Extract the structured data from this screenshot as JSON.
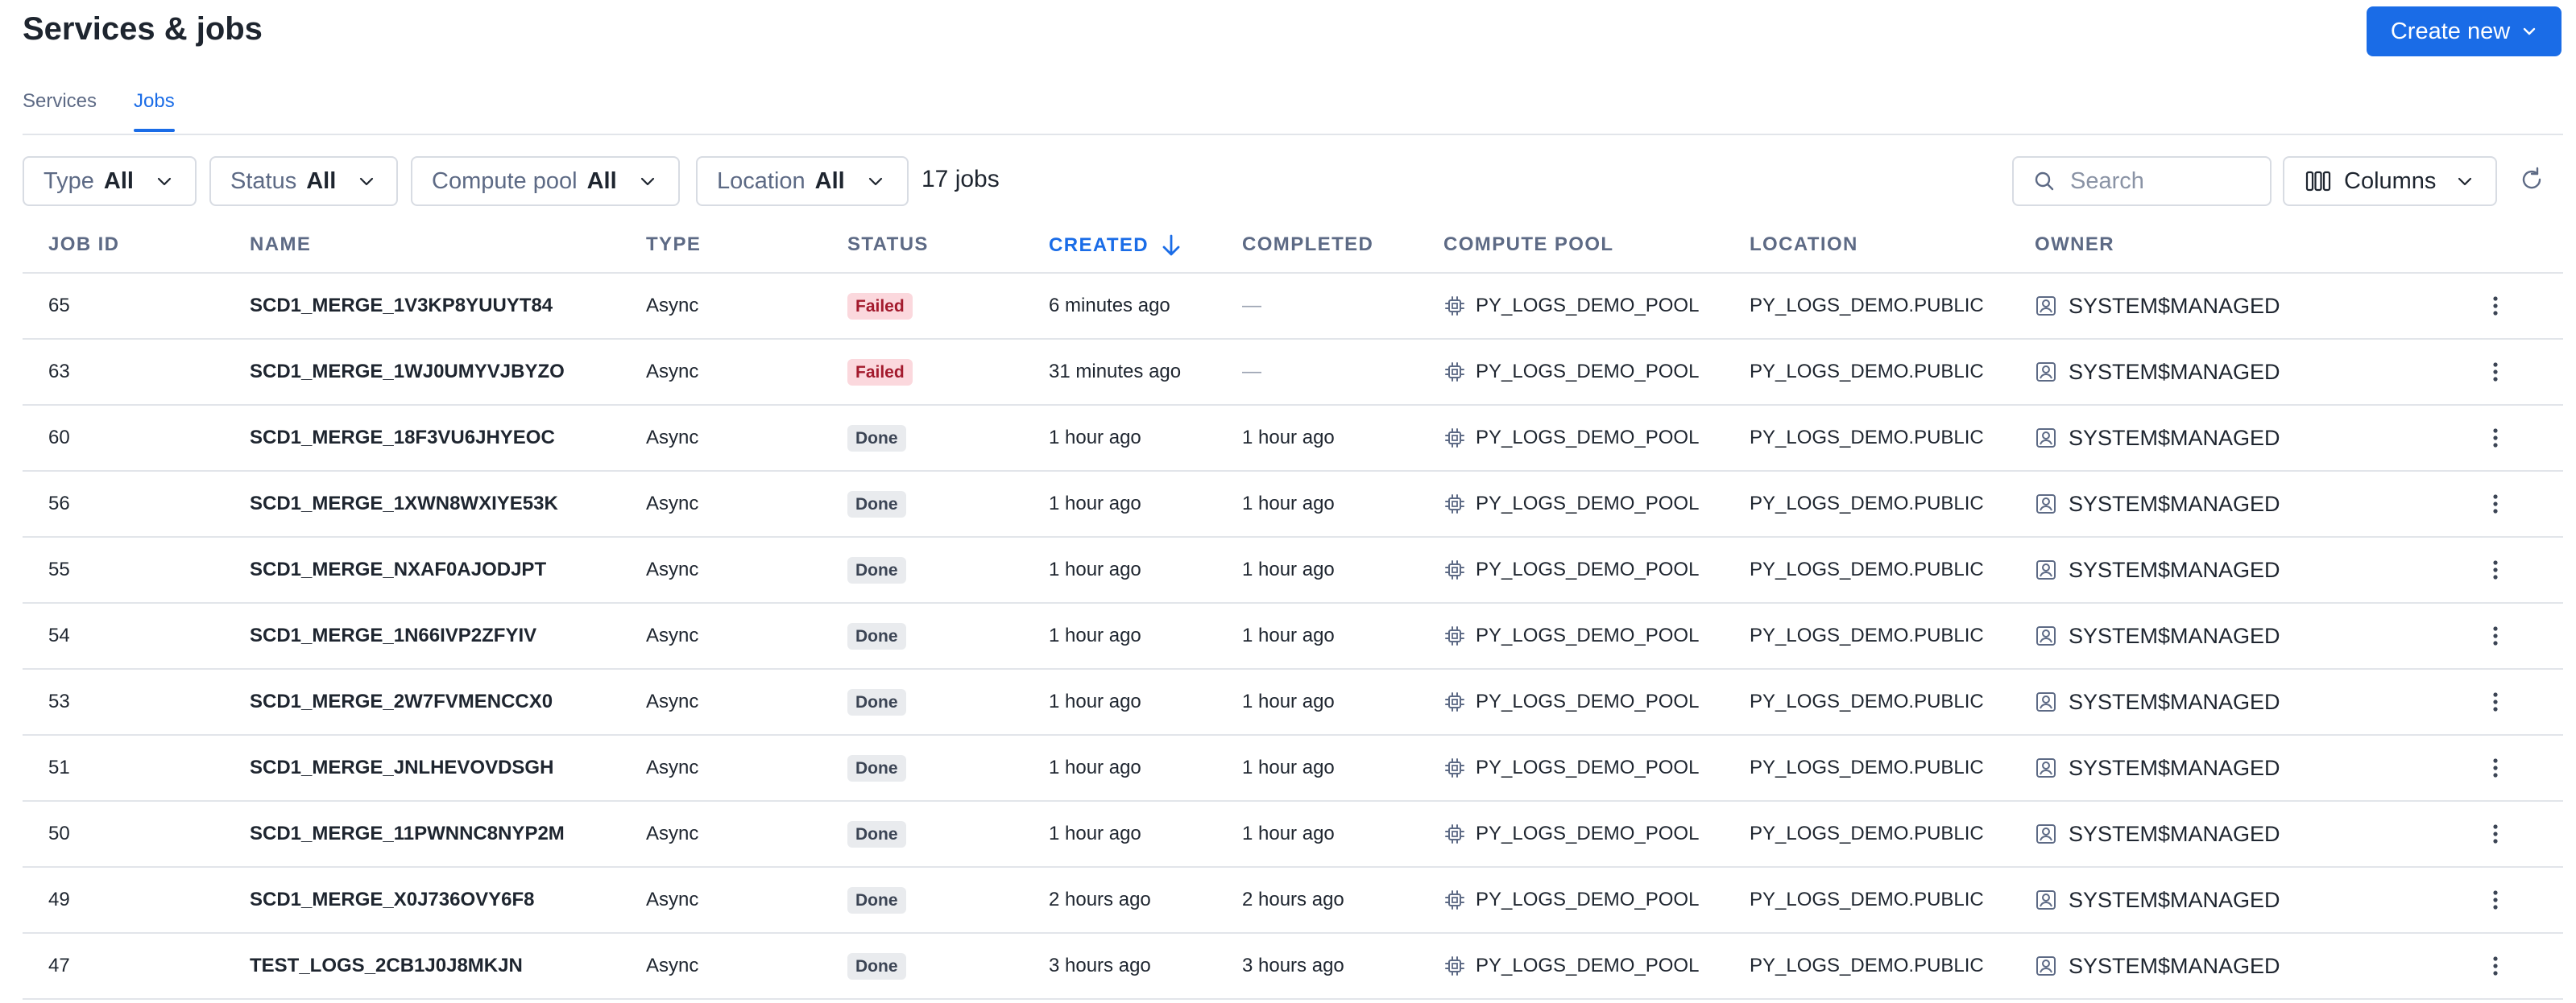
{
  "header": {
    "title": "Services & jobs",
    "create_label": "Create new"
  },
  "tabs": [
    {
      "label": "Services"
    },
    {
      "label": "Jobs"
    }
  ],
  "filters": [
    {
      "label": "Type",
      "value": "All"
    },
    {
      "label": "Status",
      "value": "All"
    },
    {
      "label": "Compute pool",
      "value": "All"
    },
    {
      "label": "Location",
      "value": "All"
    }
  ],
  "jobs_count": "17 jobs",
  "search": {
    "placeholder": "Search"
  },
  "columns_label": "Columns",
  "table": {
    "columns": [
      "JOB ID",
      "NAME",
      "TYPE",
      "STATUS",
      "CREATED",
      "COMPLETED",
      "COMPUTE POOL",
      "LOCATION",
      "OWNER"
    ],
    "sorted_column": "CREATED",
    "rows": [
      {
        "id": "65",
        "name": "SCD1_MERGE_1V3KP8YUUYT84",
        "type": "Async",
        "status": "Failed",
        "created": "6 minutes ago",
        "completed": "—",
        "pool": "PY_LOGS_DEMO_POOL",
        "location": "PY_LOGS_DEMO.PUBLIC",
        "owner": "SYSTEM$MANAGED"
      },
      {
        "id": "63",
        "name": "SCD1_MERGE_1WJ0UMYVJBYZO",
        "type": "Async",
        "status": "Failed",
        "created": "31 minutes ago",
        "completed": "—",
        "pool": "PY_LOGS_DEMO_POOL",
        "location": "PY_LOGS_DEMO.PUBLIC",
        "owner": "SYSTEM$MANAGED"
      },
      {
        "id": "60",
        "name": "SCD1_MERGE_18F3VU6JHYEOC",
        "type": "Async",
        "status": "Done",
        "created": "1 hour ago",
        "completed": "1 hour ago",
        "pool": "PY_LOGS_DEMO_POOL",
        "location": "PY_LOGS_DEMO.PUBLIC",
        "owner": "SYSTEM$MANAGED"
      },
      {
        "id": "56",
        "name": "SCD1_MERGE_1XWN8WXIYE53K",
        "type": "Async",
        "status": "Done",
        "created": "1 hour ago",
        "completed": "1 hour ago",
        "pool": "PY_LOGS_DEMO_POOL",
        "location": "PY_LOGS_DEMO.PUBLIC",
        "owner": "SYSTEM$MANAGED"
      },
      {
        "id": "55",
        "name": "SCD1_MERGE_NXAF0AJODJPT",
        "type": "Async",
        "status": "Done",
        "created": "1 hour ago",
        "completed": "1 hour ago",
        "pool": "PY_LOGS_DEMO_POOL",
        "location": "PY_LOGS_DEMO.PUBLIC",
        "owner": "SYSTEM$MANAGED"
      },
      {
        "id": "54",
        "name": "SCD1_MERGE_1N66IVP2ZFYIV",
        "type": "Async",
        "status": "Done",
        "created": "1 hour ago",
        "completed": "1 hour ago",
        "pool": "PY_LOGS_DEMO_POOL",
        "location": "PY_LOGS_DEMO.PUBLIC",
        "owner": "SYSTEM$MANAGED"
      },
      {
        "id": "53",
        "name": "SCD1_MERGE_2W7FVMENCCX0",
        "type": "Async",
        "status": "Done",
        "created": "1 hour ago",
        "completed": "1 hour ago",
        "pool": "PY_LOGS_DEMO_POOL",
        "location": "PY_LOGS_DEMO.PUBLIC",
        "owner": "SYSTEM$MANAGED"
      },
      {
        "id": "51",
        "name": "SCD1_MERGE_JNLHEVOVDSGH",
        "type": "Async",
        "status": "Done",
        "created": "1 hour ago",
        "completed": "1 hour ago",
        "pool": "PY_LOGS_DEMO_POOL",
        "location": "PY_LOGS_DEMO.PUBLIC",
        "owner": "SYSTEM$MANAGED"
      },
      {
        "id": "50",
        "name": "SCD1_MERGE_11PWNNC8NYP2M",
        "type": "Async",
        "status": "Done",
        "created": "1 hour ago",
        "completed": "1 hour ago",
        "pool": "PY_LOGS_DEMO_POOL",
        "location": "PY_LOGS_DEMO.PUBLIC",
        "owner": "SYSTEM$MANAGED"
      },
      {
        "id": "49",
        "name": "SCD1_MERGE_X0J736OVY6F8",
        "type": "Async",
        "status": "Done",
        "created": "2 hours ago",
        "completed": "2 hours ago",
        "pool": "PY_LOGS_DEMO_POOL",
        "location": "PY_LOGS_DEMO.PUBLIC",
        "owner": "SYSTEM$MANAGED"
      },
      {
        "id": "47",
        "name": "TEST_LOGS_2CB1J0J8MKJN",
        "type": "Async",
        "status": "Done",
        "created": "3 hours ago",
        "completed": "3 hours ago",
        "pool": "PY_LOGS_DEMO_POOL",
        "location": "PY_LOGS_DEMO.PUBLIC",
        "owner": "SYSTEM$MANAGED"
      }
    ]
  },
  "icons": {
    "create_chevron": "chevron-down-icon",
    "filter_chevron": "chevron-down-icon",
    "search": "search-icon",
    "columns": "columns-icon",
    "refresh": "refresh-icon",
    "sort": "arrow-down-icon",
    "pool": "chip-icon",
    "owner": "user-badge-icon",
    "menu": "more-vertical-icon"
  },
  "colors": {
    "accent": "#1a6ce7",
    "failed_bg": "#fbd8dd",
    "failed_text": "#a31a2d",
    "done_bg": "#e9ebee"
  }
}
